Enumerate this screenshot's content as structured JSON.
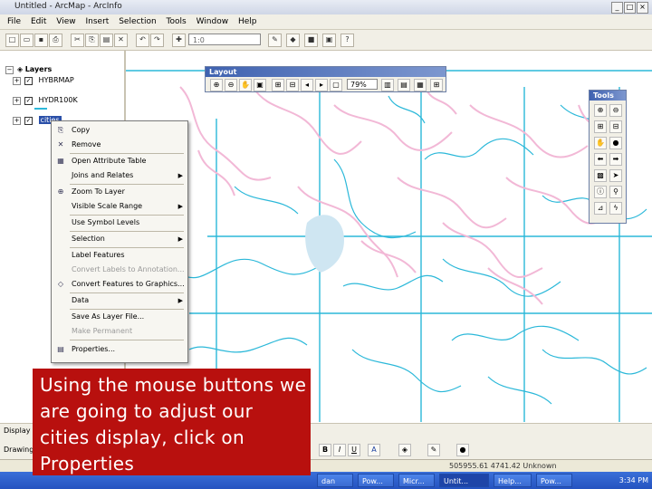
{
  "window": {
    "title": "Untitled - ArcMap - ArcInfo",
    "min": "_",
    "max": "□",
    "close": "×"
  },
  "menu": [
    "File",
    "Edit",
    "View",
    "Insert",
    "Selection",
    "Tools",
    "Window",
    "Help"
  ],
  "toolbar": {
    "scale_value": "1:0"
  },
  "toc": {
    "root_label": "Layers",
    "layers": [
      {
        "label": "HYBRMAP"
      },
      {
        "label": "HYDR100K"
      },
      {
        "label": "cities"
      }
    ]
  },
  "layout_toolbar": {
    "title": "Layout",
    "zoom_value": "79%"
  },
  "tools_toolbar": {
    "title": "Tools"
  },
  "context_menu": {
    "items": [
      {
        "label": "Copy",
        "icon": "copy-icon",
        "glyph": "⎘"
      },
      {
        "label": "Remove",
        "icon": "remove-icon",
        "glyph": "✕"
      },
      {
        "label": "Open Attribute Table",
        "icon": "table-icon",
        "glyph": "▦"
      },
      {
        "label": "Joins and Relates",
        "submenu": true
      },
      {
        "label": "Zoom To Layer",
        "icon": "zoom-layer-icon",
        "glyph": "⊕"
      },
      {
        "label": "Visible Scale Range",
        "submenu": true
      },
      {
        "label": "Use Symbol Levels"
      },
      {
        "label": "Selection",
        "submenu": true
      },
      {
        "label": "Label Features"
      },
      {
        "label": "Convert Labels to Annotation...",
        "disabled": true
      },
      {
        "label": "Convert Features to Graphics...",
        "icon": "convert-icon",
        "glyph": "◇"
      },
      {
        "label": "Data",
        "submenu": true
      },
      {
        "label": "Save As Layer File..."
      },
      {
        "label": "Make Permanent",
        "disabled": true
      },
      {
        "label": "Properties...",
        "icon": "properties-icon",
        "glyph": "▤"
      }
    ]
  },
  "callout": {
    "text": "Using the mouse buttons we are going to adjust our cities display, click on Properties"
  },
  "drawing": {
    "display_tab": "Display",
    "drawing_label": "Drawing"
  },
  "status": {
    "coords": "505955.61  4741.42 Unknown"
  },
  "taskbar": {
    "items": [
      "dan",
      "Pow...",
      "Micr...",
      "Untit...",
      "Help...",
      "Pow..."
    ],
    "clock": "3:34 PM"
  },
  "colors": {
    "rivers": "#2bb8d9",
    "streams": "#f2b8d6",
    "callout": "#b8100e",
    "titlebar_accent": "#3f62b0",
    "lake": "#cfe6f2"
  }
}
